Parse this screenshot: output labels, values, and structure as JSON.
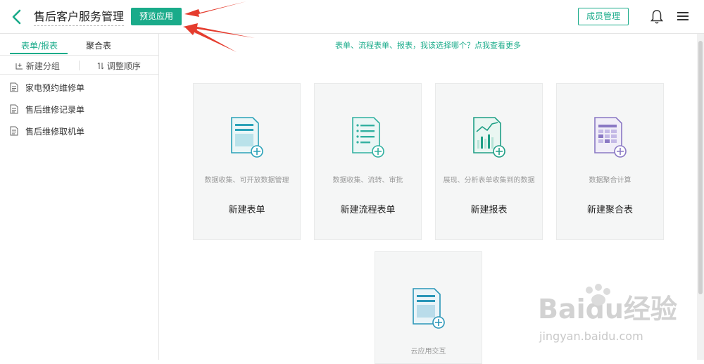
{
  "header": {
    "app_title": "售后客户服务管理",
    "preview_label": "预览应用",
    "member_label": "成员管理",
    "accent_color": "#1aab8a"
  },
  "sidebar": {
    "tabs": [
      {
        "label": "表单/报表",
        "active": true
      },
      {
        "label": "聚合表",
        "active": false
      }
    ],
    "tools": [
      {
        "label": "新建分组",
        "icon": "new-group-icon"
      },
      {
        "label": "调整顺序",
        "icon": "sort-icon"
      }
    ],
    "items": [
      {
        "label": "家电预约维修单",
        "icon": "document-icon"
      },
      {
        "label": "售后维修记录单",
        "icon": "document-icon"
      },
      {
        "label": "售后维修取机单",
        "icon": "document-icon"
      }
    ]
  },
  "main": {
    "help_link": "表单、流程表单、报表，我该选择哪个？点我查看更多",
    "cards": [
      {
        "desc": "数据收集、可开放数据管理",
        "name": "新建表单",
        "icon": "form-add-icon"
      },
      {
        "desc": "数据收集、流转、审批",
        "name": "新建流程表单",
        "icon": "flow-form-add-icon"
      },
      {
        "desc": "展现、分析表单收集到的数据",
        "name": "新建报表",
        "icon": "report-add-icon"
      },
      {
        "desc": "数据聚合计算",
        "name": "新建聚合表",
        "icon": "aggregate-add-icon"
      },
      {
        "desc": "云应用交互",
        "name": "",
        "icon": "cloud-app-add-icon"
      }
    ]
  },
  "watermark": {
    "brand": "Baidu经验",
    "url": "jingyan.baidu.com"
  }
}
